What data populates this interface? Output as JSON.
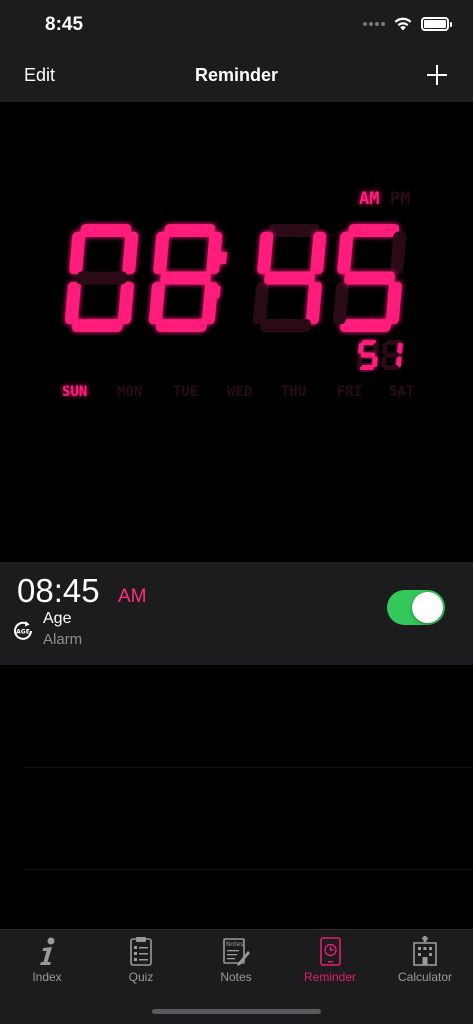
{
  "status_bar": {
    "time": "8:45"
  },
  "nav": {
    "edit_label": "Edit",
    "title": "Reminder",
    "add_icon": "plus-icon"
  },
  "clock": {
    "ampm_active": "AM",
    "ampm_inactive": "PM",
    "hours": "08",
    "minutes": "45",
    "seconds": "51",
    "days": [
      "SUN",
      "MON",
      "TUE",
      "WED",
      "THU",
      "FRI",
      "SAT"
    ],
    "active_day": "SUN",
    "accent_color": "#ff1f7a"
  },
  "alarm": {
    "time": "08:45",
    "ampm": "AM",
    "label": "Age",
    "sub_label": "Alarm",
    "icon": "age-refresh-icon",
    "enabled": true,
    "toggle_color": "#34c759"
  },
  "tabs": [
    {
      "label": "Index",
      "icon": "info-icon",
      "active": false
    },
    {
      "label": "Quiz",
      "icon": "clipboard-icon",
      "active": false
    },
    {
      "label": "Notes",
      "icon": "notes-icon",
      "active": false
    },
    {
      "label": "Reminder",
      "icon": "clock-icon",
      "active": true
    },
    {
      "label": "Calculator",
      "icon": "building-icon",
      "active": false
    }
  ],
  "active_color": "#e0206f"
}
